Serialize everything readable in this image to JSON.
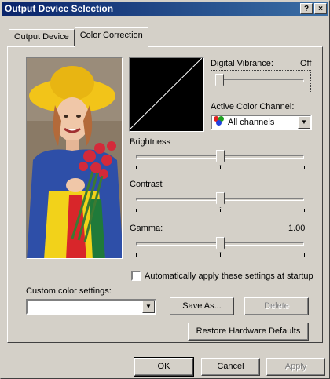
{
  "window": {
    "title": "Output Device Selection",
    "help_label": "?",
    "close_label": "×"
  },
  "tabs": [
    {
      "label": "Output Device",
      "active": false
    },
    {
      "label": "Color Correction",
      "active": true
    }
  ],
  "digital_vibrance": {
    "label": "Digital Vibrance:",
    "value": "Off",
    "level": 0.0
  },
  "active_channel": {
    "label": "Active Color Channel:",
    "selected": "All channels"
  },
  "brightness": {
    "label": "Brightness",
    "level": 0.5
  },
  "contrast": {
    "label": "Contrast",
    "level": 0.5
  },
  "gamma": {
    "label": "Gamma:",
    "value": "1.00",
    "level": 0.5
  },
  "auto_apply": {
    "label": "Automatically apply these settings at startup",
    "checked": false
  },
  "custom_settings": {
    "label": "Custom color settings:",
    "value": ""
  },
  "buttons": {
    "save_as": "Save As...",
    "delete": "Delete",
    "restore": "Restore Hardware Defaults",
    "ok": "OK",
    "cancel": "Cancel",
    "apply": "Apply"
  },
  "colors": {
    "title_start": "#0a246a",
    "title_end": "#3a6ea5",
    "face": "#d4d0c8"
  },
  "icons": [
    "help-icon",
    "close-icon",
    "color-channel-icon",
    "dropdown-arrow-icon"
  ]
}
